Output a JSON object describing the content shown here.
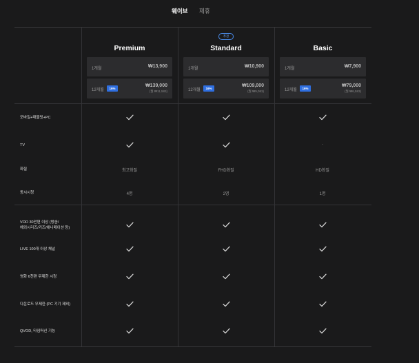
{
  "tabs": {
    "active": "웨이브",
    "other": "제휴"
  },
  "plans": [
    {
      "name": "Premium",
      "badge": "",
      "monthly": {
        "period": "1개월",
        "price": "₩13,900"
      },
      "yearly": {
        "period": "12개월",
        "discount": "16%",
        "price": "₩139,000",
        "per_month": "(월 ₩11,583)"
      }
    },
    {
      "name": "Standard",
      "badge": "추천",
      "monthly": {
        "period": "1개월",
        "price": "₩10,900"
      },
      "yearly": {
        "period": "12개월",
        "discount": "16%",
        "price": "₩109,000",
        "per_month": "(월 ₩9,083)"
      }
    },
    {
      "name": "Basic",
      "badge": "",
      "monthly": {
        "period": "1개월",
        "price": "₩7,900"
      },
      "yearly": {
        "period": "12개월",
        "discount": "16%",
        "price": "₩79,000",
        "per_month": "(월 ₩6,583)"
      }
    }
  ],
  "features": [
    {
      "label": "모바일+태블릿+PC",
      "values": [
        "check",
        "check",
        "check"
      ]
    },
    {
      "label": "TV",
      "values": [
        "check",
        "check",
        "-"
      ]
    },
    {
      "label": "화질",
      "values": [
        "최고화질",
        "FHD화질",
        "HD화질"
      ]
    },
    {
      "label": "동시시청",
      "values": [
        "4명",
        "2명",
        "1명"
      ]
    },
    {
      "label": "VOD 30만편 이상 (방송/\n해외시리즈/키즈/애니메이션 등)",
      "values": [
        "check",
        "check",
        "check"
      ]
    },
    {
      "label": "LIVE 100개 이상 채널",
      "values": [
        "check",
        "check",
        "check"
      ]
    },
    {
      "label": "영화 6천편 무제한 시청",
      "values": [
        "check",
        "check",
        "check"
      ]
    },
    {
      "label": "다운로드 무제한 (PC 기기 제외)",
      "values": [
        "check",
        "check",
        "check"
      ]
    },
    {
      "label": "QVOD, 타임머신 기능",
      "values": [
        "check",
        "check",
        "check"
      ]
    }
  ],
  "colors": {
    "accent": "#2f6fe0",
    "background": "#1a1a1b",
    "price_box": "#2c2c2e"
  },
  "icons": {
    "check": "check-icon"
  }
}
